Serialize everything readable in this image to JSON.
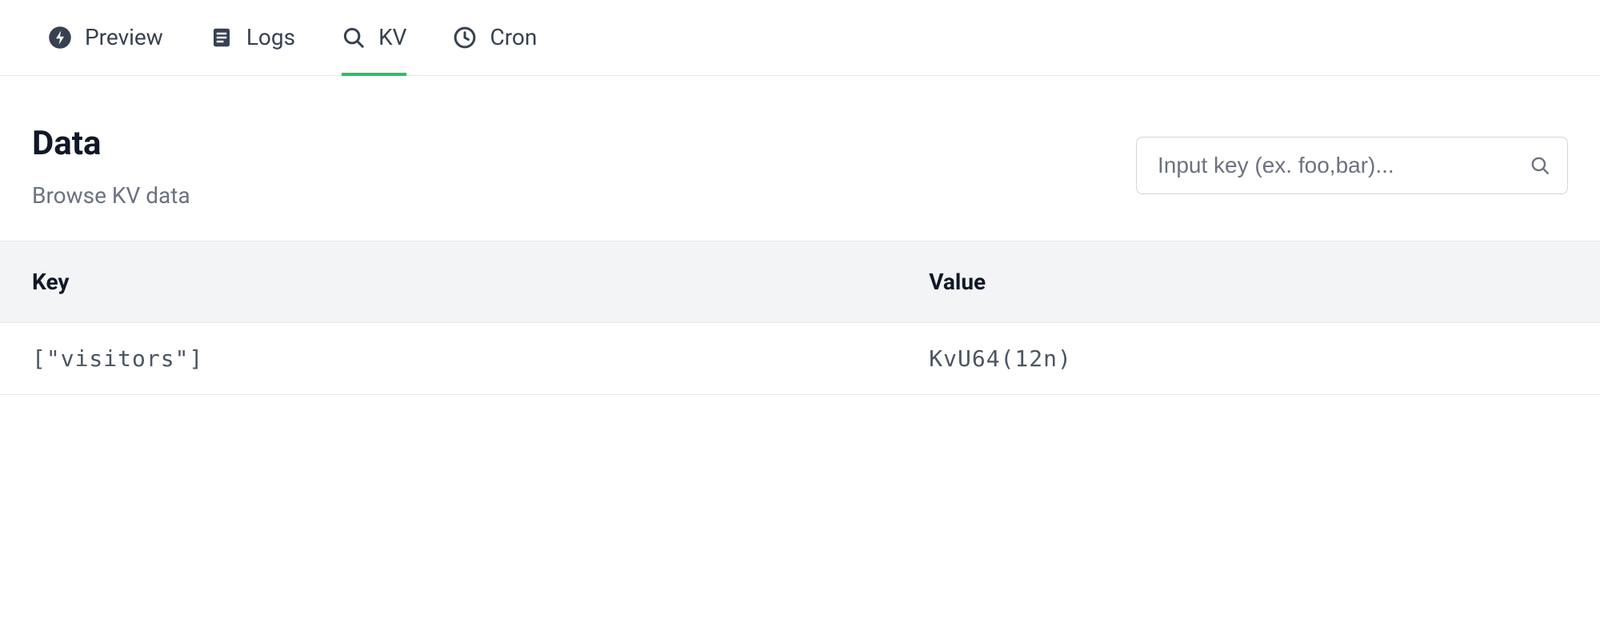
{
  "tabs": [
    {
      "id": "preview",
      "label": "Preview",
      "active": false
    },
    {
      "id": "logs",
      "label": "Logs",
      "active": false
    },
    {
      "id": "kv",
      "label": "KV",
      "active": true
    },
    {
      "id": "cron",
      "label": "Cron",
      "active": false
    }
  ],
  "header": {
    "title": "Data",
    "subtitle": "Browse KV data"
  },
  "search": {
    "placeholder": "Input key (ex. foo,bar)..."
  },
  "columns": {
    "key": "Key",
    "value": "Value"
  },
  "rows": [
    {
      "key": "[\"visitors\"]",
      "value": "KvU64(12n)"
    }
  ]
}
